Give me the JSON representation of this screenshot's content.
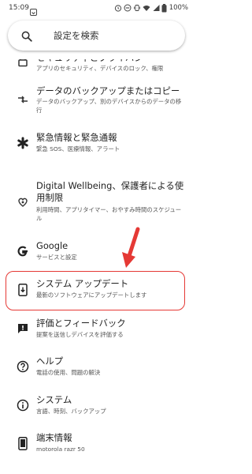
{
  "status_bar": {
    "time": "15:09",
    "battery": "100%",
    "icons": [
      "notification-icon",
      "alarm-icon",
      "do-not-disturb-icon",
      "vibrate-icon",
      "wifi-icon",
      "signal-icon",
      "battery-icon"
    ]
  },
  "search": {
    "placeholder": "設定を検索"
  },
  "items": [
    {
      "title": "セキュリティとプライバシー",
      "subtitle": "アプリのセキュリティ、デバイスのロック、権限",
      "icon": "lock-icon"
    },
    {
      "title": "データのバックアップまたはコピー",
      "subtitle": "データのバックアップ、別のデバイスからのデータの移行",
      "icon": "transfer-icon"
    },
    {
      "title": "緊急情報と緊急通報",
      "subtitle": "緊急 SOS、医療情報、アラート",
      "icon": "asterisk-icon"
    },
    {
      "title": "Digital Wellbeing、保護者による使用制限",
      "subtitle": "利用時間、アプリタイマー、おやすみ時間のスケジュール",
      "icon": "wellbeing-icon"
    },
    {
      "title": "Google",
      "subtitle": "サービスと設定",
      "icon": "google-icon"
    },
    {
      "title": "システム アップデート",
      "subtitle": "最新のソフトウェアにアップデートします",
      "icon": "system-update-icon"
    },
    {
      "title": "評価とフィードバック",
      "subtitle": "提案を送信しデバイスを評価する",
      "icon": "feedback-icon"
    },
    {
      "title": "ヘルプ",
      "subtitle": "電話の使用、問題の解決",
      "icon": "help-icon"
    },
    {
      "title": "システム",
      "subtitle": "言語、時刻、バックアップ",
      "icon": "system-info-icon"
    },
    {
      "title": "端末情報",
      "subtitle": "motorola razr 50",
      "icon": "device-info-icon"
    }
  ],
  "annotation": {
    "color": "#e53935",
    "highlighted_item": "システム アップデート"
  }
}
